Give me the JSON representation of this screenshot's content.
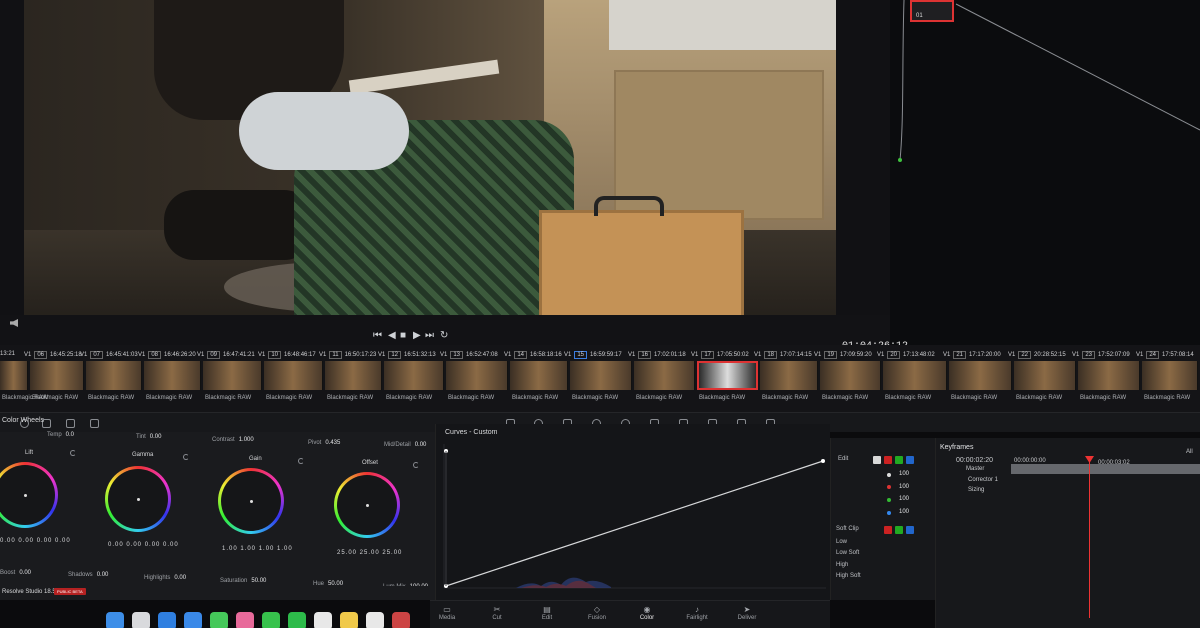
{
  "viewer": {
    "timecode": "01:04:26:12"
  },
  "node": {
    "label": "01"
  },
  "clips": [
    {
      "left_tc": "13:21",
      "label": "Blackmagic RAW"
    },
    {
      "num": "06",
      "tc": "16:45:25:18",
      "label": "Blackmagic RAW"
    },
    {
      "num": "07",
      "tc": "16:45:41:03",
      "label": "Blackmagic RAW"
    },
    {
      "num": "08",
      "tc": "16:46:26:20",
      "label": "Blackmagic RAW"
    },
    {
      "num": "09",
      "tc": "16:47:41:21",
      "label": "Blackmagic RAW"
    },
    {
      "num": "10",
      "tc": "16:48:46:17",
      "label": "Blackmagic RAW"
    },
    {
      "num": "11",
      "tc": "16:50:17:23",
      "label": "Blackmagic RAW"
    },
    {
      "num": "12",
      "tc": "16:51:32:13",
      "label": "Blackmagic RAW"
    },
    {
      "num": "13",
      "tc": "16:52:47:08",
      "label": "Blackmagic RAW"
    },
    {
      "num": "14",
      "tc": "16:58:18:16",
      "label": "Blackmagic RAW"
    },
    {
      "num": "15",
      "tc": "16:59:59:17",
      "label": "Blackmagic RAW"
    },
    {
      "num": "16",
      "tc": "17:02:01:18",
      "label": "Blackmagic RAW"
    },
    {
      "num": "17",
      "tc": "17:05:50:02",
      "label": "Blackmagic RAW"
    },
    {
      "num": "18",
      "tc": "17:07:14:15",
      "label": "Blackmagic RAW"
    },
    {
      "num": "19",
      "tc": "17:09:59:20",
      "label": "Blackmagic RAW"
    },
    {
      "num": "20",
      "tc": "17:13:48:02",
      "label": "Blackmagic RAW"
    },
    {
      "num": "21",
      "tc": "17:17:20:00",
      "label": "Blackmagic RAW"
    },
    {
      "num": "22",
      "tc": "20:28:52:15",
      "label": "Blackmagic RAW"
    },
    {
      "num": "23",
      "tc": "17:52:07:09",
      "label": "Blackmagic RAW"
    },
    {
      "num": "24",
      "tc": "17:57:08:14",
      "label": "Blackmagic RAW"
    }
  ],
  "track": "V1",
  "wheels": {
    "title": "Color Wheels",
    "temp": {
      "label": "Temp",
      "value": "0.0"
    },
    "tint": {
      "label": "Tint",
      "value": "0.00"
    },
    "contrast": {
      "label": "Contrast",
      "value": "1.000"
    },
    "pivot": {
      "label": "Pivot",
      "value": "0.435"
    },
    "middetail": {
      "label": "Mid/Detail",
      "value": "0.00"
    },
    "lift": {
      "name": "Lift",
      "values": "0.00 0.00 0.00 0.00"
    },
    "gamma": {
      "name": "Gamma",
      "values": "0.00 0.00 0.00 0.00"
    },
    "gain": {
      "name": "Gain",
      "values": "1.00 1.00 1.00 1.00"
    },
    "offset": {
      "name": "Offset",
      "values": "25.00 25.00 25.00"
    },
    "boost": {
      "label": "Boost",
      "value": "0.00"
    },
    "shadows": {
      "label": "Shadows",
      "value": "0.00"
    },
    "highlights": {
      "label": "Highlights",
      "value": "0.00"
    },
    "saturation": {
      "label": "Saturation",
      "value": "50.00"
    },
    "hue": {
      "label": "Hue",
      "value": "50.00"
    },
    "lummix": {
      "label": "Lum Mix",
      "value": "100.00"
    }
  },
  "curves": {
    "title": "Curves - Custom"
  },
  "edit": {
    "title": "Edit",
    "channel_values": [
      "100",
      "100",
      "100",
      "100"
    ],
    "softclip_title": "Soft Clip",
    "low": "Low",
    "low_soft": "Low Soft",
    "high": "High",
    "high_soft": "High Soft",
    "y_label": "Y",
    "r_label": "R",
    "g_label": "G",
    "b_label": "B"
  },
  "keyframes": {
    "title": "Keyframes",
    "filter": "All",
    "current_tc": "00:00:02:20",
    "start_tc": "00:00:00:00",
    "ruler_tc": "00:00:03:02",
    "rows": [
      "Master",
      "Corrector 1",
      "Sizing"
    ]
  },
  "app": {
    "name": "Resolve Studio 18.5",
    "badge": "PUBLIC BETA"
  },
  "pages": [
    {
      "label": "Media",
      "glyph": "▭"
    },
    {
      "label": "Cut",
      "glyph": "✂"
    },
    {
      "label": "Edit",
      "glyph": "▤"
    },
    {
      "label": "Fusion",
      "glyph": "◇"
    },
    {
      "label": "Color",
      "glyph": "◉",
      "active": true
    },
    {
      "label": "Fairlight",
      "glyph": "♪"
    },
    {
      "label": "Deliver",
      "glyph": "➤"
    }
  ],
  "colors": {
    "accent_red": "#dd3333",
    "accent_blue": "#3b7de0",
    "panel_bg": "#1a1b1e"
  }
}
